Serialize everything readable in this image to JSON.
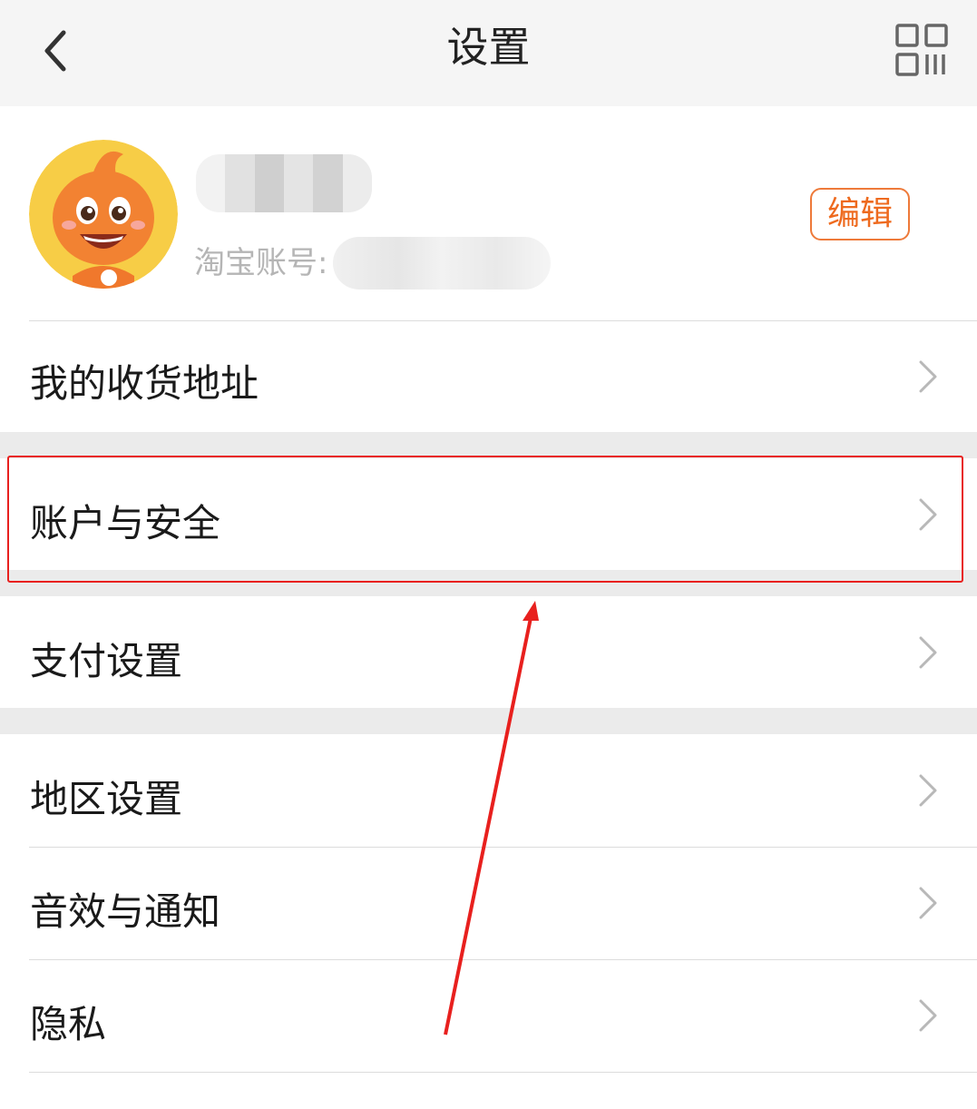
{
  "header": {
    "title": "设置",
    "back_icon": "chevron-left-icon",
    "qr_icon": "qr-code-icon"
  },
  "profile": {
    "account_label": "淘宝账号:",
    "edit_label": "编辑"
  },
  "menu": {
    "items": [
      {
        "label": "我的收货地址"
      },
      {
        "label": "账户与安全"
      },
      {
        "label": "支付设置"
      },
      {
        "label": "地区设置"
      },
      {
        "label": "音效与通知"
      },
      {
        "label": "隐私"
      }
    ]
  },
  "colors": {
    "accent": "#ee6a1e",
    "annotation": "#e8201e",
    "background": "#ebebeb"
  }
}
